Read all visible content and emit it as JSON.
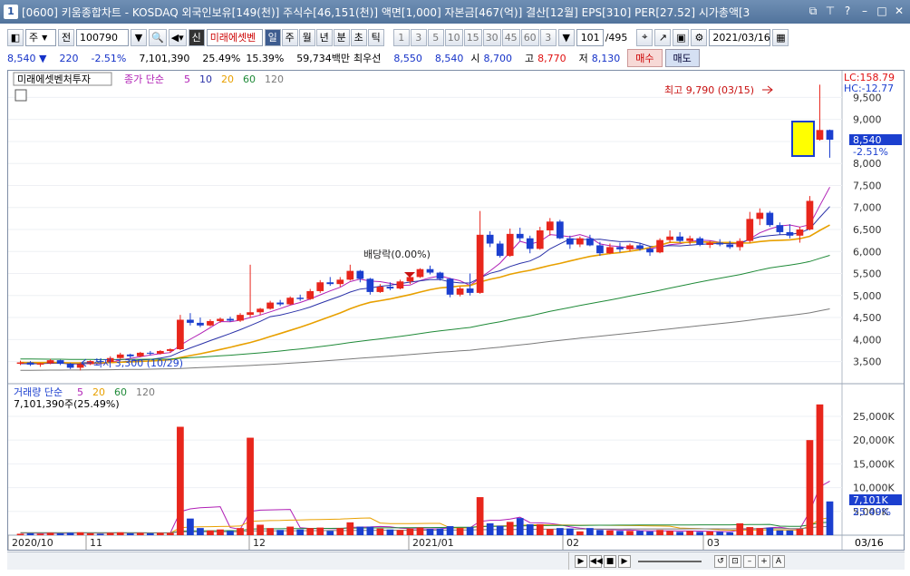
{
  "window": {
    "num": "1",
    "title": "[0600] 키움종합차트 - KOSDAQ 외국인보유[149(천)] 주식수[46,151(천)] 액면[1,000] 자본금[467(억)] 결산[12월] EPS[310] PER[27.52] 시가총액[3"
  },
  "toolbar": {
    "period_sel": "주",
    "prev_label": "전",
    "code": "100790",
    "badge": "신",
    "name": "미래에셋벤",
    "periods": [
      "일",
      "주",
      "월",
      "년",
      "분",
      "초",
      "틱"
    ],
    "intervals": [
      "1",
      "3",
      "5",
      "10",
      "15",
      "30",
      "45",
      "60",
      "3"
    ],
    "count": "101",
    "total": "/495",
    "date": "2021/03/16"
  },
  "quote": {
    "price": "8,540",
    "change": "220",
    "change_pct": "-2.51%",
    "volume": "7,101,390",
    "volume_pct": "25.49%",
    "turnover": "15.39%",
    "amount": "59,734백만",
    "best_label": "최우선",
    "ask": "8,550",
    "bid": "8,540",
    "open_label": "시",
    "open": "8,700",
    "high_label": "고",
    "high": "8,770",
    "low_label": "저",
    "low": "8,130",
    "buy": "매수",
    "sell": "매도"
  },
  "chart": {
    "stock_title": "미래에셋벤처투자",
    "ma_label": "종가 단순",
    "ma_periods": [
      "5",
      "10",
      "20",
      "60",
      "120"
    ],
    "lc": "LC:158.79",
    "hc": "HC:-12.77",
    "high_note": "최고 9,790 (03/15)",
    "low_note": "최저 3,300 (10/29)",
    "div_note": "배당락(0.00%)",
    "price_tag": "8,540",
    "price_tag_pct": "-2.51%",
    "price_ticks": [
      "9,500",
      "9,000",
      "8,500",
      "8,000",
      "7,500",
      "7,000",
      "6,500",
      "6,000",
      "5,500",
      "5,000",
      "4,500",
      "4,000",
      "3,500"
    ],
    "vol_label": "거래량 단순",
    "vol_periods": [
      "5",
      "20",
      "60",
      "120"
    ],
    "vol_value": "7,101,390주(25.49%)",
    "vol_ticks": [
      "25,000K",
      "20,000K",
      "15,000K",
      "10,000K",
      "5,000K"
    ],
    "vol_tag": "7,101K",
    "vol_tag_pct": "25.49%",
    "x_labels": [
      "2020/10",
      "11",
      "12",
      "2021/01",
      "02",
      "03"
    ],
    "x_date": "03/16"
  },
  "colors": {
    "up": "#e8261c",
    "down": "#1b3fcf",
    "ma5": "#b01fb5",
    "ma10": "#2a31a8",
    "ma20": "#e8a000",
    "ma60": "#1f8a38",
    "ma120": "#7a7a7a"
  },
  "chart_data": {
    "type": "candlestick",
    "ohlc": [
      [
        3450,
        3520,
        3420,
        3480
      ],
      [
        3480,
        3510,
        3400,
        3430
      ],
      [
        3430,
        3470,
        3380,
        3460
      ],
      [
        3460,
        3560,
        3440,
        3530
      ],
      [
        3530,
        3540,
        3420,
        3450
      ],
      [
        3450,
        3470,
        3330,
        3360
      ],
      [
        3360,
        3480,
        3300,
        3440
      ],
      [
        3440,
        3530,
        3420,
        3510
      ],
      [
        3510,
        3560,
        3470,
        3490
      ],
      [
        3490,
        3620,
        3480,
        3580
      ],
      [
        3580,
        3700,
        3560,
        3660
      ],
      [
        3660,
        3680,
        3580,
        3620
      ],
      [
        3620,
        3720,
        3600,
        3700
      ],
      [
        3700,
        3740,
        3640,
        3680
      ],
      [
        3680,
        3760,
        3660,
        3740
      ],
      [
        3740,
        3800,
        3700,
        3780
      ],
      [
        3780,
        4560,
        3760,
        4450
      ],
      [
        4450,
        4600,
        4320,
        4380
      ],
      [
        4380,
        4500,
        4280,
        4320
      ],
      [
        4320,
        4460,
        4300,
        4420
      ],
      [
        4420,
        4500,
        4380,
        4470
      ],
      [
        4470,
        4520,
        4400,
        4430
      ],
      [
        4430,
        4600,
        4400,
        4560
      ],
      [
        4560,
        5700,
        4500,
        4620
      ],
      [
        4620,
        4720,
        4560,
        4700
      ],
      [
        4700,
        4880,
        4680,
        4840
      ],
      [
        4840,
        4900,
        4760,
        4800
      ],
      [
        4800,
        4980,
        4780,
        4950
      ],
      [
        4950,
        5020,
        4880,
        4920
      ],
      [
        4920,
        5150,
        4900,
        5100
      ],
      [
        5100,
        5350,
        5060,
        5300
      ],
      [
        5300,
        5420,
        5220,
        5260
      ],
      [
        5260,
        5420,
        5200,
        5360
      ],
      [
        5360,
        5700,
        5340,
        5560
      ],
      [
        5560,
        5580,
        5300,
        5380
      ],
      [
        5380,
        5400,
        5020,
        5080
      ],
      [
        5080,
        5260,
        5060,
        5200
      ],
      [
        5200,
        5300,
        5120,
        5160
      ],
      [
        5160,
        5360,
        5140,
        5320
      ],
      [
        5320,
        5460,
        5260,
        5420
      ],
      [
        5420,
        5620,
        5400,
        5600
      ],
      [
        5600,
        5680,
        5480,
        5520
      ],
      [
        5520,
        5540,
        5340,
        5380
      ],
      [
        5380,
        5400,
        4960,
        5020
      ],
      [
        5020,
        5200,
        4980,
        5160
      ],
      [
        5160,
        5500,
        5000,
        5060
      ],
      [
        5060,
        6920,
        5040,
        6380
      ],
      [
        6380,
        6460,
        6100,
        6180
      ],
      [
        6180,
        6240,
        5860,
        5900
      ],
      [
        5900,
        6520,
        5880,
        6400
      ],
      [
        6400,
        6540,
        6240,
        6300
      ],
      [
        6300,
        6360,
        5960,
        6060
      ],
      [
        6060,
        6560,
        6040,
        6480
      ],
      [
        6480,
        6760,
        6360,
        6680
      ],
      [
        6680,
        6720,
        6280,
        6300
      ],
      [
        6300,
        6360,
        6060,
        6160
      ],
      [
        6160,
        6340,
        6100,
        6300
      ],
      [
        6300,
        6380,
        6120,
        6140
      ],
      [
        6140,
        6220,
        5900,
        5960
      ],
      [
        5960,
        6180,
        5940,
        6100
      ],
      [
        6100,
        6200,
        5980,
        6050
      ],
      [
        6050,
        6180,
        6000,
        6140
      ],
      [
        6140,
        6200,
        6020,
        6060
      ],
      [
        6060,
        6100,
        5900,
        5980
      ],
      [
        5980,
        6300,
        5960,
        6260
      ],
      [
        6260,
        6480,
        6200,
        6340
      ],
      [
        6340,
        6440,
        6200,
        6240
      ],
      [
        6240,
        6360,
        6160,
        6300
      ],
      [
        6300,
        6340,
        6120,
        6150
      ],
      [
        6150,
        6240,
        6080,
        6200
      ],
      [
        6200,
        6280,
        6120,
        6160
      ],
      [
        6160,
        6240,
        6060,
        6100
      ],
      [
        6100,
        6300,
        6020,
        6240
      ],
      [
        6240,
        6900,
        6200,
        6740
      ],
      [
        6740,
        6980,
        6600,
        6880
      ],
      [
        6880,
        6920,
        6560,
        6600
      ],
      [
        6600,
        6660,
        6380,
        6440
      ],
      [
        6440,
        6620,
        6300,
        6360
      ],
      [
        6360,
        6560,
        6200,
        6500
      ],
      [
        6500,
        7260,
        6480,
        7150
      ],
      [
        8540,
        9790,
        8520,
        8760
      ],
      [
        8760,
        8770,
        8130,
        8540
      ]
    ],
    "volume": [
      0.3,
      0.4,
      0.3,
      0.5,
      0.4,
      0.5,
      0.6,
      0.4,
      0.3,
      0.5,
      0.6,
      0.4,
      0.5,
      0.4,
      0.5,
      0.5,
      22.8,
      3.5,
      1.5,
      1.0,
      1.2,
      0.9,
      1.5,
      20.5,
      2.2,
      1.5,
      1.1,
      1.8,
      1.2,
      1.5,
      1.6,
      0.9,
      1.5,
      2.7,
      1.8,
      1.8,
      1.4,
      1.2,
      1.1,
      1.4,
      1.6,
      1.3,
      1.4,
      1.9,
      1.5,
      1.7,
      8.0,
      2.5,
      2.0,
      2.8,
      3.6,
      2.3,
      2.3,
      1.3,
      1.5,
      1.4,
      0.8,
      1.5,
      1.1,
      1.0,
      0.9,
      0.9,
      0.9,
      0.8,
      1.1,
      0.9,
      0.7,
      0.9,
      0.7,
      0.8,
      0.7,
      0.6,
      2.5,
      1.7,
      1.5,
      1.6,
      1.0,
      1.0,
      1.3,
      20.0,
      27.5,
      7.1
    ],
    "ylim": [
      3100,
      9900
    ],
    "vol_ylim_k": [
      0,
      29000
    ]
  }
}
